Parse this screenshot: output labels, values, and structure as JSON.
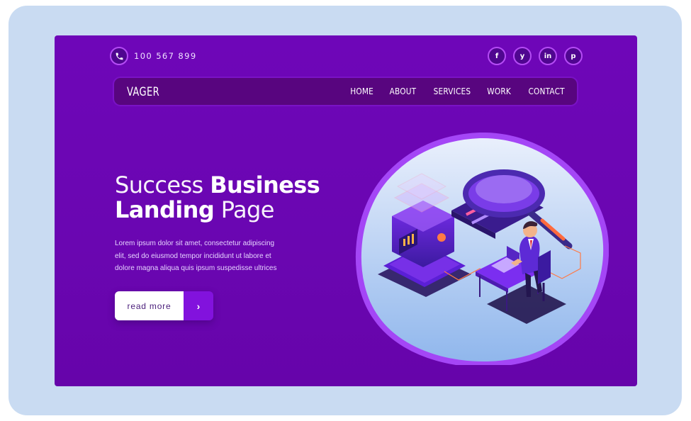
{
  "topbar": {
    "phone": "100 567 899",
    "socials": [
      {
        "icon": "facebook-icon",
        "glyph": "f"
      },
      {
        "icon": "twitter-icon",
        "glyph": "y"
      },
      {
        "icon": "linkedin-icon",
        "glyph": "in"
      },
      {
        "icon": "pinterest-icon",
        "glyph": "p"
      }
    ]
  },
  "nav": {
    "logo": "VAGER",
    "items": [
      "HOME",
      "ABOUT",
      "SERVICES",
      "WORK",
      "CONTACT"
    ]
  },
  "hero": {
    "title_light_1": "Success ",
    "title_bold_1": "Business",
    "title_bold_2": "Landing",
    "title_light_2": " Page",
    "body_line_1": "Lorem ipsum dolor sit amet, consectetur adipiscing",
    "body_line_2": "elit, sed do eiusmod tempor incididunt ut labore et",
    "body_line_3": "dolore magna aliqua quis ipsum suspedisse ultrices",
    "cta_label": "read more",
    "cta_arrow": "›"
  },
  "colors": {
    "background": "#c9dbf2",
    "page": "#6e06b8",
    "navbar": "#58057f",
    "accent": "#8212dd"
  }
}
